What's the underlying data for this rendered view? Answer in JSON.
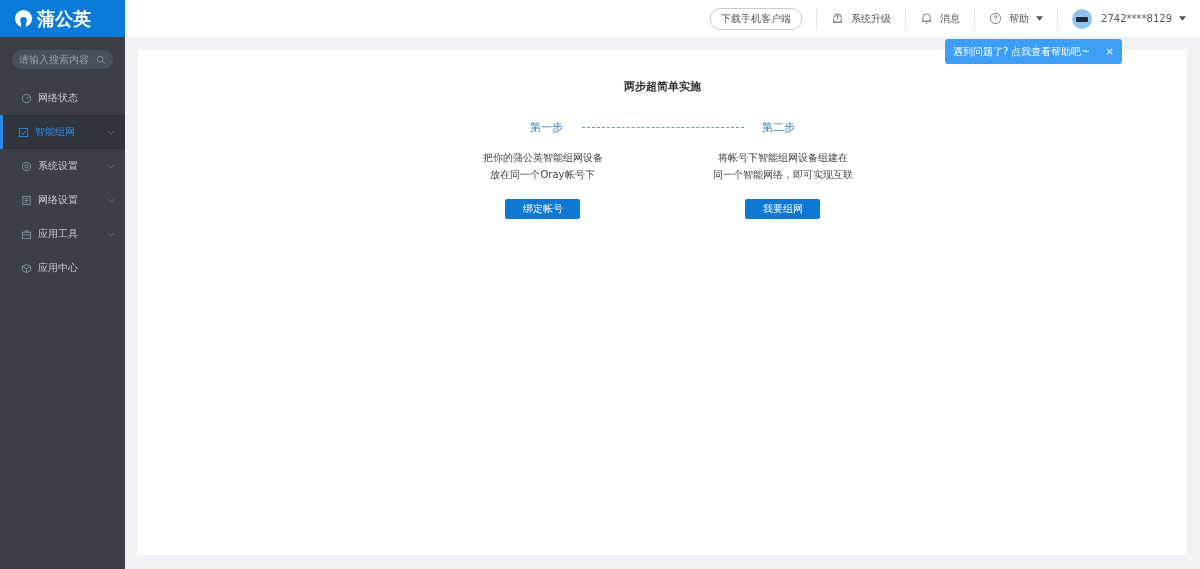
{
  "logo": {
    "text": "蒲公英"
  },
  "search": {
    "placeholder": "请输入搜索内容"
  },
  "sidebar": {
    "items": [
      {
        "label": "网络状态",
        "selected": false,
        "expandable": false
      },
      {
        "label": "智能组网",
        "selected": true,
        "expandable": true
      },
      {
        "label": "系统设置",
        "selected": false,
        "expandable": true
      },
      {
        "label": "网络设置",
        "selected": false,
        "expandable": true
      },
      {
        "label": "应用工具",
        "selected": false,
        "expandable": true
      },
      {
        "label": "应用中心",
        "selected": false,
        "expandable": false
      }
    ]
  },
  "topbar": {
    "download": "下载手机客户端",
    "items": [
      {
        "label": "系统升级",
        "dropdown": false
      },
      {
        "label": "消息",
        "dropdown": false
      },
      {
        "label": "帮助",
        "dropdown": true
      }
    ],
    "user": "2742****8129"
  },
  "tooltip": {
    "text": "遇到问题了? 点我查看帮助吧~",
    "close": "×"
  },
  "main": {
    "title": "两步超简单实施",
    "steps": [
      {
        "label": "第一步",
        "lines": [
          "把你的蒲公英智能组网设备",
          "放在同一个Oray帐号下"
        ],
        "button": "绑定帐号"
      },
      {
        "label": "第二步",
        "lines": [
          "将帐号下智能组网设备组建在",
          "同一个智能网络，即可实现互联"
        ],
        "button": "我要组网"
      }
    ]
  }
}
